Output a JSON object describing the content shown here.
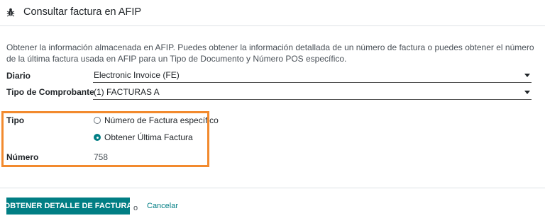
{
  "dialog": {
    "title": "Consultar factura en AFIP",
    "icon": "bug-icon"
  },
  "description": "Obtener la información almacenada en AFIP. Puedes obtener la información detallada de un número de factura o puedes obtener el número de la última factura usada en AFIP para un Tipo de Documento y Número POS específico.",
  "fields": {
    "diario": {
      "label": "Diario",
      "value": "Electronic Invoice (FE)"
    },
    "tipo_comprobante": {
      "label": "Tipo de Comprobante",
      "value": "(1) FACTURAS A"
    },
    "tipo": {
      "label": "Tipo",
      "options": [
        {
          "label": "Número de Factura específico",
          "selected": false
        },
        {
          "label": "Obtener Última Factura",
          "selected": true
        }
      ]
    },
    "numero": {
      "label": "Número",
      "value": "758"
    }
  },
  "footer": {
    "primary_label": "OBTENER DETALLE DE FACTURA",
    "or_text": "o",
    "cancel_label": "Cancelar"
  },
  "colors": {
    "accent": "#017e84",
    "highlight": "#f28a2e"
  }
}
